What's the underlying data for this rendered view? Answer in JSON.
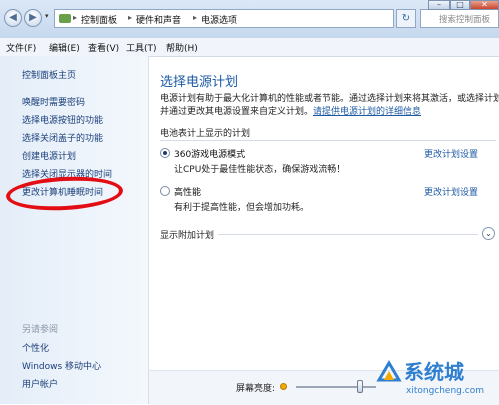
{
  "window": {
    "minimize_glyph": "–",
    "maximize_glyph": "□",
    "close_glyph": "✕"
  },
  "address_bar": {
    "back_glyph": "◀",
    "forward_glyph": "▶",
    "dropdown_glyph": "▾",
    "breadcrumbs": [
      "控制面板",
      "硬件和声音",
      "电源选项"
    ],
    "separator": "▸",
    "refresh_glyph": "↻",
    "search_placeholder": "搜索控制面板"
  },
  "menu": [
    "文件(F)",
    "编辑(E)",
    "查看(V)",
    "工具(T)",
    "帮助(H)"
  ],
  "sidebar": {
    "home": "控制面板主页",
    "tasks": [
      "唤醒时需要密码",
      "选择电源按钮的功能",
      "选择关闭盖子的功能",
      "创建电源计划",
      "选择关闭显示器的时间",
      "更改计算机睡眠时间"
    ],
    "see_also_label": "另请参阅",
    "see_also": [
      "个性化",
      "Windows 移动中心",
      "用户帐户"
    ]
  },
  "main": {
    "title": "选择电源计划",
    "desc_line1": "电源计划有助于最大化计算机的性能或者节能。通过选择计划来将其激活，或选择计划",
    "desc_line2_prefix": "并通过更改其电源设置来自定义计划。",
    "desc_link": "请提供电源计划的详细信息",
    "section_label": "电池表计上显示的计划",
    "plans": [
      {
        "name": "360游戏电源模式",
        "desc": "让CPU处于最佳性能状态，确保游戏流畅！",
        "selected": true,
        "change_label": "更改计划设置"
      },
      {
        "name": "高性能",
        "desc": "有利于提高性能，但会增加功耗。",
        "selected": false,
        "change_label": "更改计划设置"
      }
    ],
    "show_more": "显示附加计划",
    "show_more_glyph": "⌄"
  },
  "bottom": {
    "brightness_label": "屏幕亮度:",
    "brightness_level": 0.8
  },
  "watermark": {
    "text": "系统城",
    "url": "xitongcheng.com"
  },
  "colors": {
    "link": "#1c5aa6",
    "highlight_circle": "#e30d14",
    "watermark": "#2f7fd0"
  }
}
